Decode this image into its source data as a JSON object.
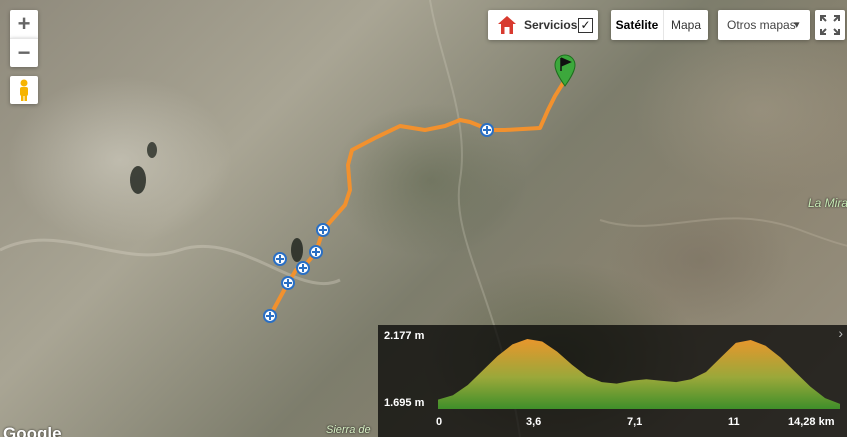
{
  "map": {
    "controls": {
      "zoom_in": "+",
      "zoom_out": "−",
      "servicios_label": "Servicios",
      "servicios_checked": "✓",
      "satelite_label": "Satélite",
      "mapa_label": "Mapa",
      "otros_mapas_label": "Otros mapas",
      "dropdown_arrow": "▾"
    },
    "place_labels": {
      "la_mira": "La Mira",
      "sierra": "Sierra de"
    },
    "google_logo": "Google",
    "route_color": "#f2912e",
    "marker_color": "#3ca83c"
  },
  "elevation_profile": {
    "y_max_label": "2.177 m",
    "y_min_label": "1.695 m",
    "x_labels": [
      "0",
      "3,6",
      "7,1",
      "11",
      "14,28 km"
    ],
    "corner_arrow": "›",
    "elevation_m": [
      1760,
      1790,
      1860,
      1960,
      2060,
      2140,
      2177,
      2160,
      2090,
      2000,
      1920,
      1880,
      1870,
      1890,
      1900,
      1890,
      1880,
      1900,
      1950,
      2050,
      2150,
      2170,
      2130,
      2050,
      1950,
      1850,
      1770,
      1730
    ],
    "min_m": 1695,
    "max_m": 2177,
    "total_km": 14.28
  }
}
